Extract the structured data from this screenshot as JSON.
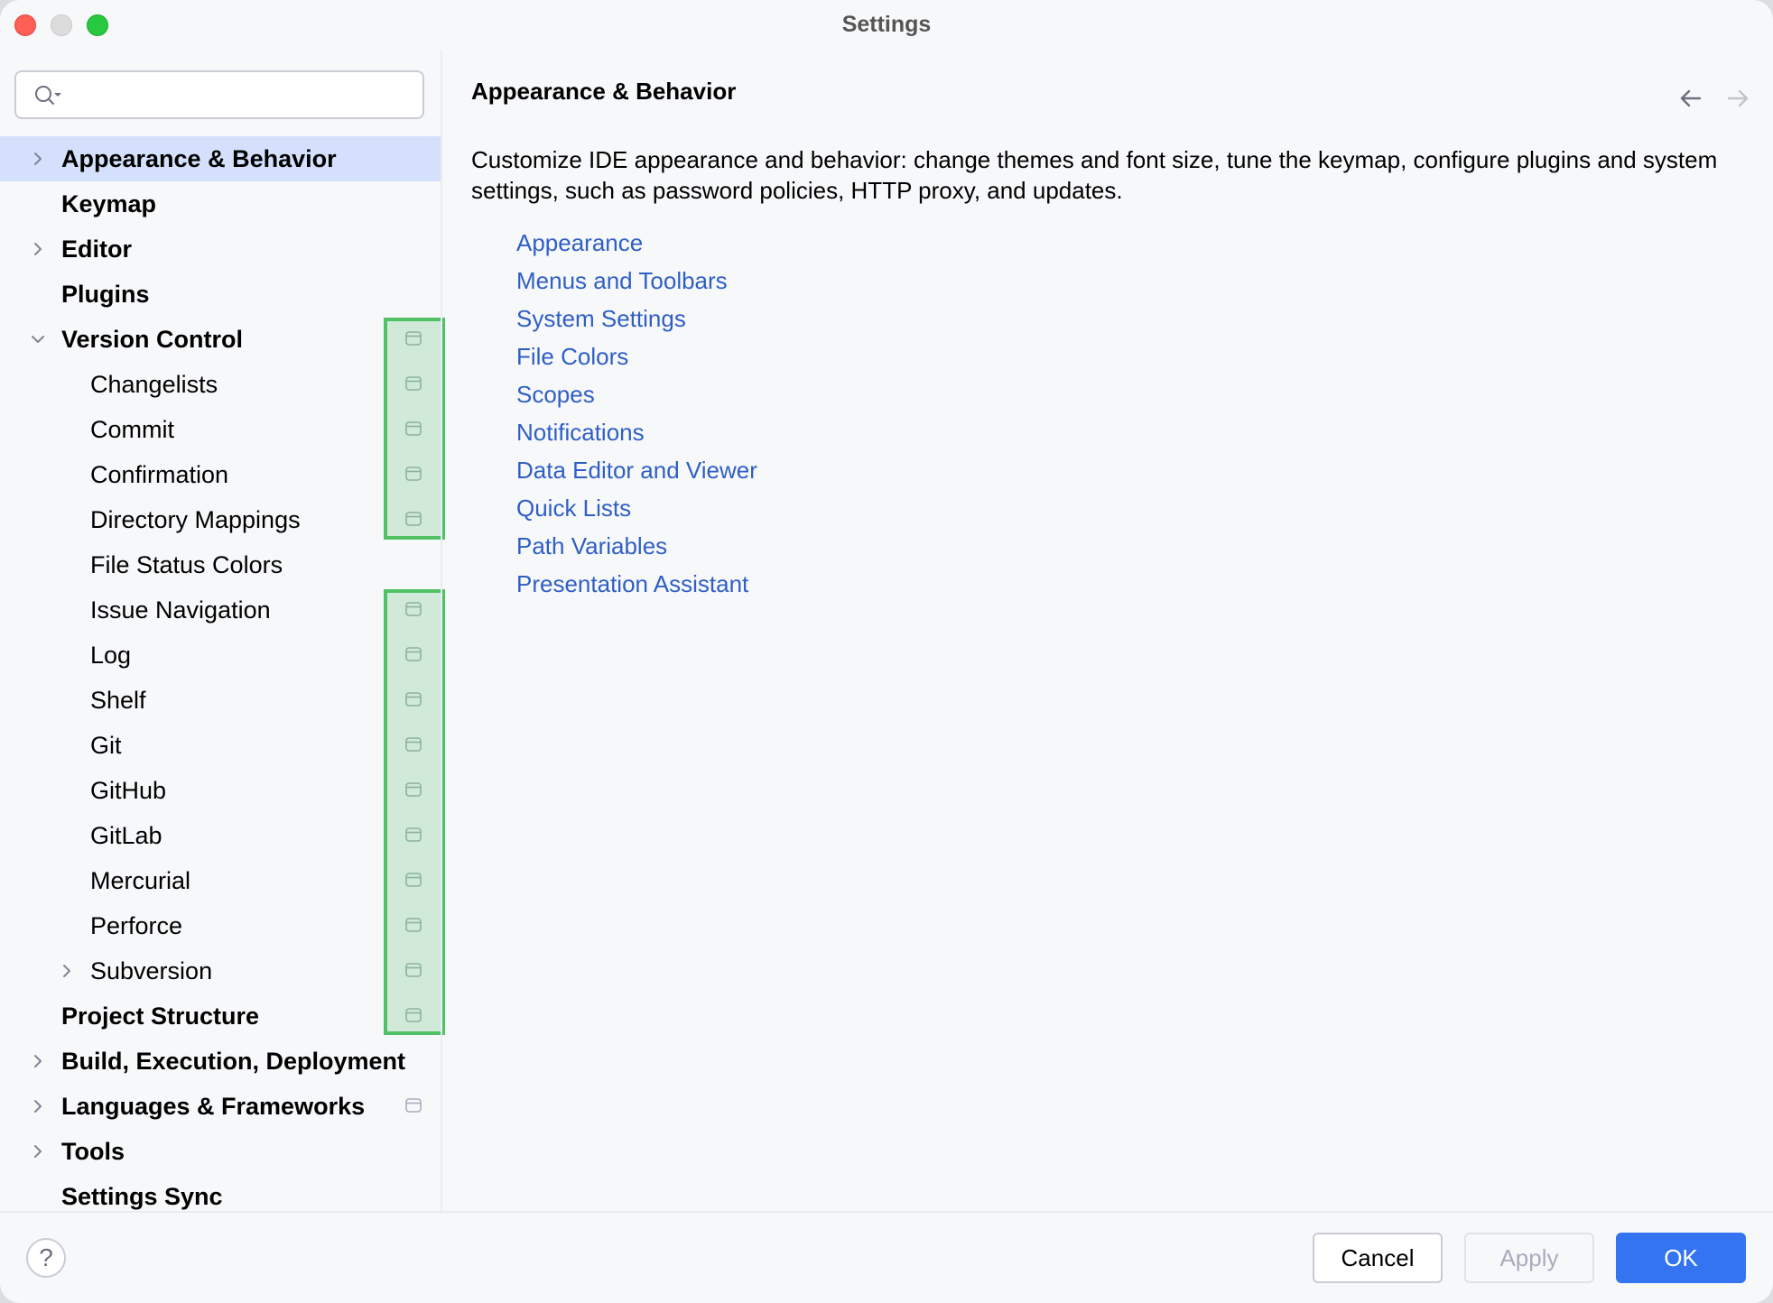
{
  "window": {
    "title": "Settings"
  },
  "search": {
    "value": "",
    "placeholder": ""
  },
  "tree": [
    {
      "label": "Appearance & Behavior",
      "level": 0,
      "bold": true,
      "expander": "collapsed",
      "selected": true,
      "project_icon": false,
      "highlighted": false
    },
    {
      "label": "Keymap",
      "level": 0,
      "bold": true,
      "expander": "none",
      "selected": false,
      "project_icon": false,
      "highlighted": false
    },
    {
      "label": "Editor",
      "level": 0,
      "bold": true,
      "expander": "collapsed",
      "selected": false,
      "project_icon": false,
      "highlighted": false
    },
    {
      "label": "Plugins",
      "level": 0,
      "bold": true,
      "expander": "none",
      "selected": false,
      "project_icon": false,
      "highlighted": false
    },
    {
      "label": "Version Control",
      "level": 0,
      "bold": true,
      "expander": "expanded",
      "selected": false,
      "project_icon": true,
      "highlighted": true
    },
    {
      "label": "Changelists",
      "level": 1,
      "bold": false,
      "expander": "none",
      "selected": false,
      "project_icon": true,
      "highlighted": true
    },
    {
      "label": "Commit",
      "level": 1,
      "bold": false,
      "expander": "none",
      "selected": false,
      "project_icon": true,
      "highlighted": true
    },
    {
      "label": "Confirmation",
      "level": 1,
      "bold": false,
      "expander": "none",
      "selected": false,
      "project_icon": true,
      "highlighted": true
    },
    {
      "label": "Directory Mappings",
      "level": 1,
      "bold": false,
      "expander": "none",
      "selected": false,
      "project_icon": true,
      "highlighted": true
    },
    {
      "label": "File Status Colors",
      "level": 1,
      "bold": false,
      "expander": "none",
      "selected": false,
      "project_icon": false,
      "highlighted": false
    },
    {
      "label": "Issue Navigation",
      "level": 1,
      "bold": false,
      "expander": "none",
      "selected": false,
      "project_icon": true,
      "highlighted": true
    },
    {
      "label": "Log",
      "level": 1,
      "bold": false,
      "expander": "none",
      "selected": false,
      "project_icon": true,
      "highlighted": true
    },
    {
      "label": "Shelf",
      "level": 1,
      "bold": false,
      "expander": "none",
      "selected": false,
      "project_icon": true,
      "highlighted": true
    },
    {
      "label": "Git",
      "level": 1,
      "bold": false,
      "expander": "none",
      "selected": false,
      "project_icon": true,
      "highlighted": true
    },
    {
      "label": "GitHub",
      "level": 1,
      "bold": false,
      "expander": "none",
      "selected": false,
      "project_icon": true,
      "highlighted": true
    },
    {
      "label": "GitLab",
      "level": 1,
      "bold": false,
      "expander": "none",
      "selected": false,
      "project_icon": true,
      "highlighted": true
    },
    {
      "label": "Mercurial",
      "level": 1,
      "bold": false,
      "expander": "none",
      "selected": false,
      "project_icon": true,
      "highlighted": true
    },
    {
      "label": "Perforce",
      "level": 1,
      "bold": false,
      "expander": "none",
      "selected": false,
      "project_icon": true,
      "highlighted": true
    },
    {
      "label": "Subversion",
      "level": 1,
      "bold": false,
      "expander": "collapsed",
      "selected": false,
      "project_icon": true,
      "highlighted": true
    },
    {
      "label": "Project Structure",
      "level": 0,
      "bold": true,
      "expander": "none",
      "selected": false,
      "project_icon": true,
      "highlighted": true
    },
    {
      "label": "Build, Execution, Deployment",
      "level": 0,
      "bold": true,
      "expander": "collapsed",
      "selected": false,
      "project_icon": false,
      "highlighted": false
    },
    {
      "label": "Languages & Frameworks",
      "level": 0,
      "bold": true,
      "expander": "collapsed",
      "selected": false,
      "project_icon": true,
      "highlighted": false
    },
    {
      "label": "Tools",
      "level": 0,
      "bold": true,
      "expander": "collapsed",
      "selected": false,
      "project_icon": false,
      "highlighted": false
    },
    {
      "label": "Settings Sync",
      "level": 0,
      "bold": true,
      "expander": "none",
      "selected": false,
      "project_icon": false,
      "highlighted": false
    }
  ],
  "content": {
    "title": "Appearance & Behavior",
    "description": "Customize IDE appearance and behavior: change themes and font size, tune the keymap, configure plugins and system settings, such as password policies, HTTP proxy, and updates.",
    "links": [
      "Appearance",
      "Menus and Toolbars",
      "System Settings",
      "File Colors",
      "Scopes",
      "Notifications",
      "Data Editor and Viewer",
      "Quick Lists",
      "Path Variables",
      "Presentation Assistant"
    ],
    "nav": {
      "back_enabled": true,
      "forward_enabled": false
    }
  },
  "footer": {
    "help_label": "?",
    "cancel_label": "Cancel",
    "apply_label": "Apply",
    "apply_enabled": false,
    "ok_label": "OK"
  },
  "colors": {
    "accent": "#3574f0",
    "link": "#2f5fc4",
    "selection": "#d5e1fc",
    "highlight_border": "#51c166",
    "highlight_fill": "#cfe8d4"
  }
}
